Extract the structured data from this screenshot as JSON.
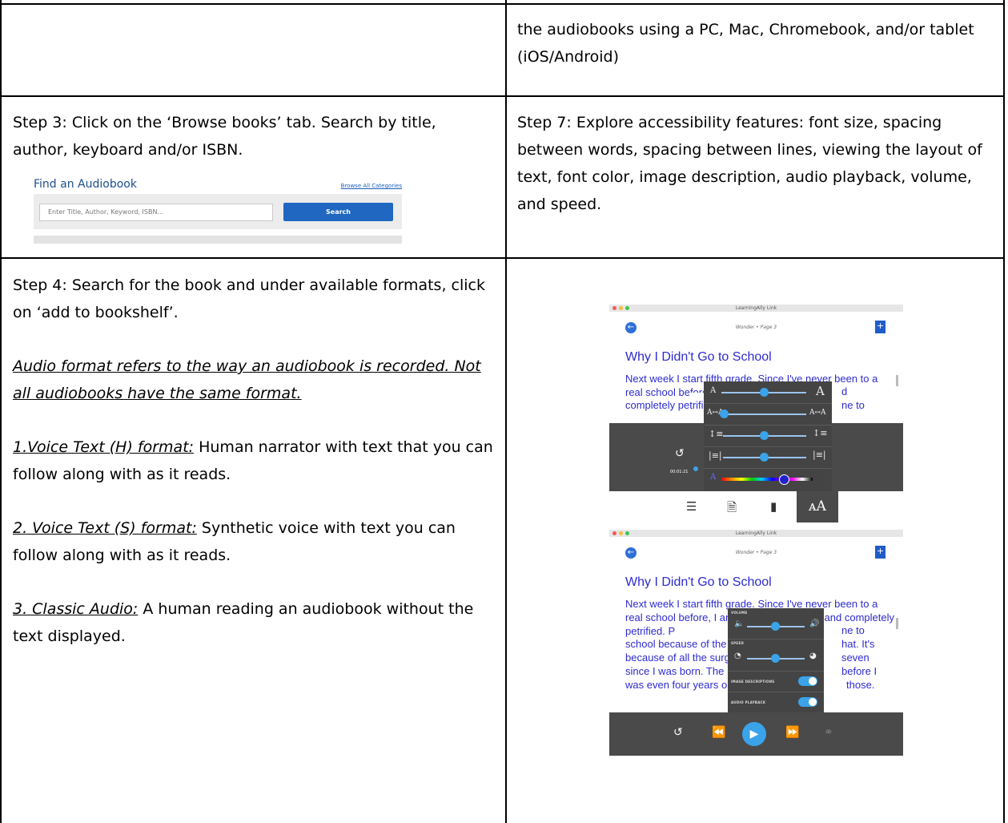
{
  "row1": {
    "right_text": "the audiobooks using a PC, Mac, Chromebook, and/or tablet (iOS/Android)"
  },
  "row2": {
    "left_text": "Step 3: Click on the ‘Browse books’ tab.  Search by title, author, keyboard and/or ISBN.",
    "right_text": "Step 7:  Explore accessibility features: font size, spacing between words, spacing between lines, viewing the layout of text, font color, image description, audio playback, volume, and speed."
  },
  "find_audiobook": {
    "title": "Find an Audiobook",
    "browse_link": "Browse All Categories",
    "search_placeholder": "Enter Title, Author, Keyword, ISBN...",
    "search_button": "Search"
  },
  "row3": {
    "step4": "Step 4:  Search for the book and under available formats, click on ‘add to bookshelf’.",
    "note": "Audio format refers to the way an audiobook is recorded.  Not all audiobooks have the same format.",
    "f1_label": "1.Voice Text (H)  format:",
    "f1_text": " Human narrator with text that you can follow along with as it reads.",
    "f2_label": "2. Voice Text (S)  format:",
    "f2_text": " Synthetic voice with text you can follow along with as it reads.",
    "f3_label": "3. Classic Audio:",
    "f3_text": "  A human reading an audiobook without the text displayed."
  },
  "app": {
    "window_title": "LearningAlly Link",
    "page_info": "Wonder • Page 3",
    "book_title": "Why I Didn't Go to School",
    "text_1": "Next week I start fifth grade. Since I've never been to a real school before",
    "text_1_frag_a": "d",
    "text_1_frag_b": "completely petrifi",
    "text_1_frag_c": "ne to",
    "elapsed": "00:01:21",
    "text_2": "Next week I start fifth grade. Since I've never been to a real school before, I am pretty much totally and completely petrified. P",
    "text_2_frag": "ne to",
    "text_2_line4a": "school because of the",
    "text_2_line4b": "hat. It's",
    "text_2_line5a": "because of all the surg",
    "text_2_line5b": "seven",
    "text_2_line6a": "since I was born. The",
    "text_2_line6b": "before I",
    "text_2_line7a": "was even four years o",
    "text_2_line7b": "those.",
    "volume_label": "VOLUME",
    "speed_label": "SPEED",
    "image_desc_label": "IMAGE DESCRIPTIONS",
    "audio_playback_label": "AUDIO PLAYBACK"
  },
  "settings": {
    "font_size_level": 0.5,
    "word_spacing_level": 0.0,
    "line_spacing_level": 0.5,
    "layout_level": 0.5,
    "color_level": 0.83,
    "volume_level": 0.5,
    "speed_level": 0.5,
    "image_descriptions": true,
    "audio_playback": true
  },
  "colors": {
    "text_blue": "#2e2bd0",
    "accent": "#3aa3ea"
  }
}
